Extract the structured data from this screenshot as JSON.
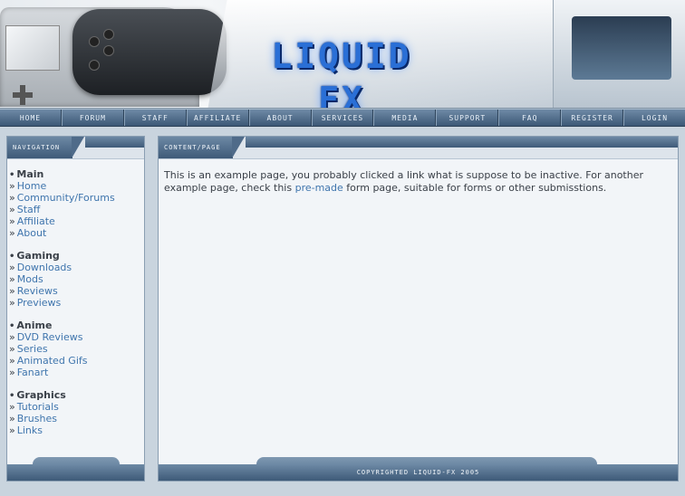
{
  "header": {
    "logo_text": "LIQUID FX"
  },
  "navbar": {
    "items": [
      "HOME",
      "FORUM",
      "STAFF",
      "AFFILIATE",
      "ABOUT",
      "SERVICES",
      "MEDIA",
      "SUPPORT",
      "FAQ",
      "REGISTER",
      "LOGIN"
    ]
  },
  "sidebar": {
    "title": "NAVIGATION",
    "groups": [
      {
        "title": "Main",
        "links": [
          "Home",
          "Community/Forums",
          "Staff",
          "Affiliate",
          "About"
        ]
      },
      {
        "title": "Gaming",
        "links": [
          "Downloads",
          "Mods",
          "Reviews",
          "Previews"
        ]
      },
      {
        "title": "Anime",
        "links": [
          "DVD Reviews",
          "Series",
          "Animated Gifs",
          "Fanart"
        ]
      },
      {
        "title": "Graphics",
        "links": [
          "Tutorials",
          "Brushes",
          "Links"
        ]
      }
    ],
    "bullet": "•",
    "link_prefix": "»"
  },
  "main": {
    "title": "CONTENT/PAGE",
    "text_before": "This is an example page, you probably clicked a link what is suppose to be inactive. For another example page, check this ",
    "link_text": "pre-made",
    "text_after": " form page, suitable for forms or other submisstions.",
    "footer": "COPYRIGHTED LIQUID-FX 2005"
  },
  "colors": {
    "accent": "#3f75ad",
    "nav_bar": "#4f6b89",
    "panel_bg": "#f2f5f8"
  }
}
